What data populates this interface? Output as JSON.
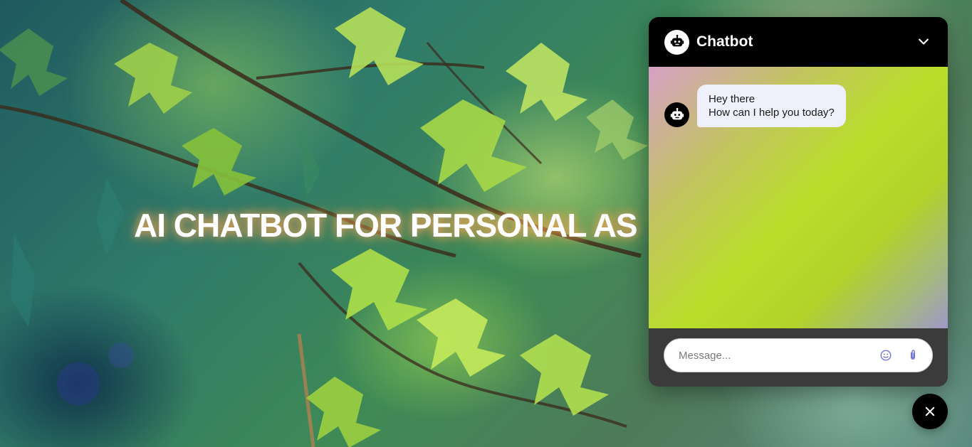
{
  "hero": {
    "title": "AI CHATBOT FOR PERSONAL AS"
  },
  "chatbot": {
    "header": {
      "title": "Chatbot",
      "avatar_icon": "robot-icon",
      "collapse_icon": "chevron-down-icon"
    },
    "messages": [
      {
        "sender": "bot",
        "lines": [
          "Hey there",
          "How can I help you today?"
        ]
      }
    ],
    "composer": {
      "placeholder": "Message...",
      "value": "",
      "emoji_icon": "smiley-icon",
      "attach_icon": "paperclip-icon"
    },
    "close_icon": "close-icon"
  },
  "colors": {
    "header_bg": "#000000",
    "footer_bg": "#3b3b3b",
    "bubble_bg": "#eef0fb",
    "icon_accent": "#6b6fd4",
    "title_glow": "#ff9a3c"
  }
}
